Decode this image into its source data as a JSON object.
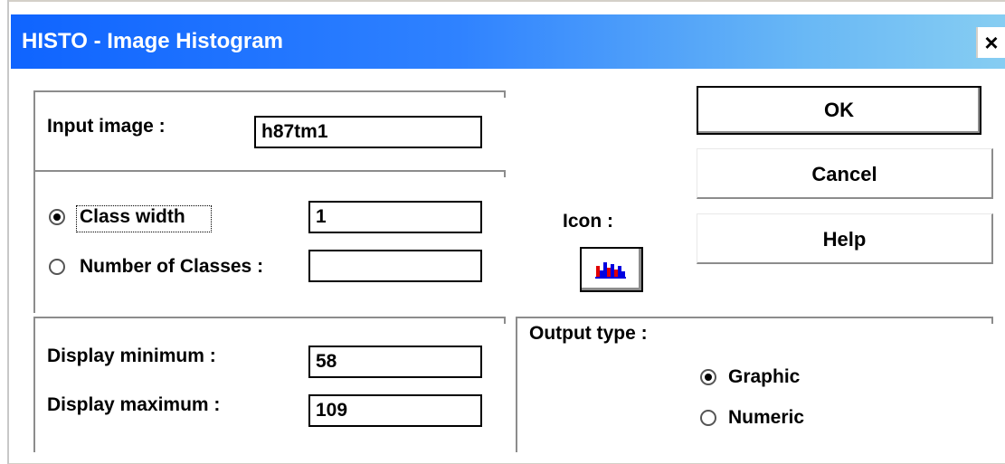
{
  "window": {
    "title": "HISTO - Image Histogram",
    "close_label": "×"
  },
  "input": {
    "label": "Input image :",
    "value": "h87tm1"
  },
  "classes": {
    "class_width_label": "Class width",
    "class_width_value": "1",
    "class_width_selected": true,
    "number_label": "Number of Classes :",
    "number_value": "",
    "number_selected": false
  },
  "display": {
    "min_label": "Display minimum :",
    "min_value": "58",
    "max_label": "Display maximum :",
    "max_value": "109"
  },
  "icon": {
    "label": "Icon :",
    "name": "histogram-icon"
  },
  "output": {
    "label": "Output type :",
    "options": [
      {
        "label": "Graphic",
        "selected": true
      },
      {
        "label": "Numeric",
        "selected": false
      }
    ]
  },
  "buttons": {
    "ok": "OK",
    "cancel": "Cancel",
    "help": "Help"
  },
  "colors": {
    "title_start": "#0f64ff",
    "title_end": "#86cdf2",
    "histogram_red": "#e00000",
    "histogram_blue": "#0000e0"
  }
}
